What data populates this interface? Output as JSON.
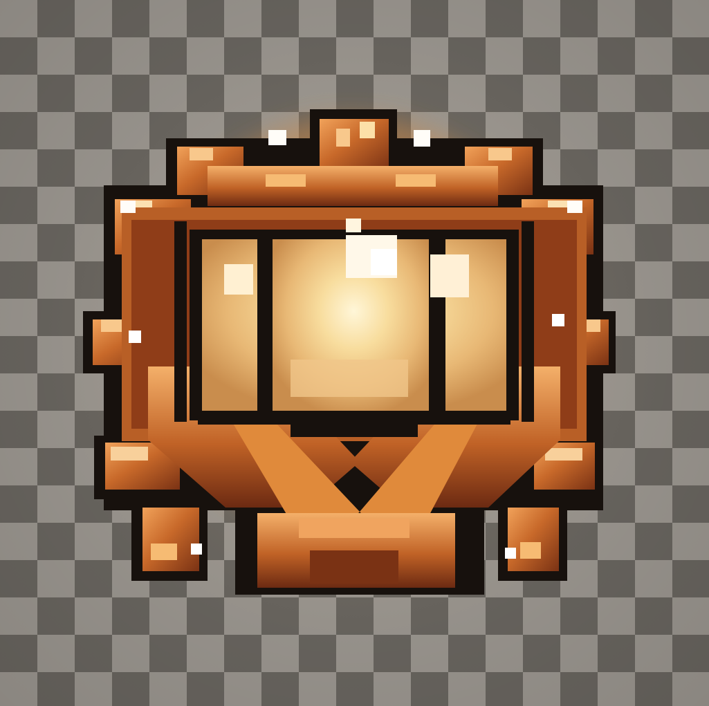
{
  "scene": {
    "background": "transparency-checkerboard",
    "sprite": "pixel-art-golden-emblem"
  },
  "colors": {
    "checker_light": "#a19c95",
    "checker_dark": "#6d6963",
    "outline": "#17110d",
    "bronze_dark": "#7a3214",
    "bronze_mid": "#b85f26",
    "bronze_light": "#e08a3b",
    "gold_highlight": "#f5c27a",
    "orb_core": "#fff2c9",
    "orb_light": "#f9dca2",
    "orb_mid": "#e6b97b",
    "spark": "#fffdf8"
  }
}
